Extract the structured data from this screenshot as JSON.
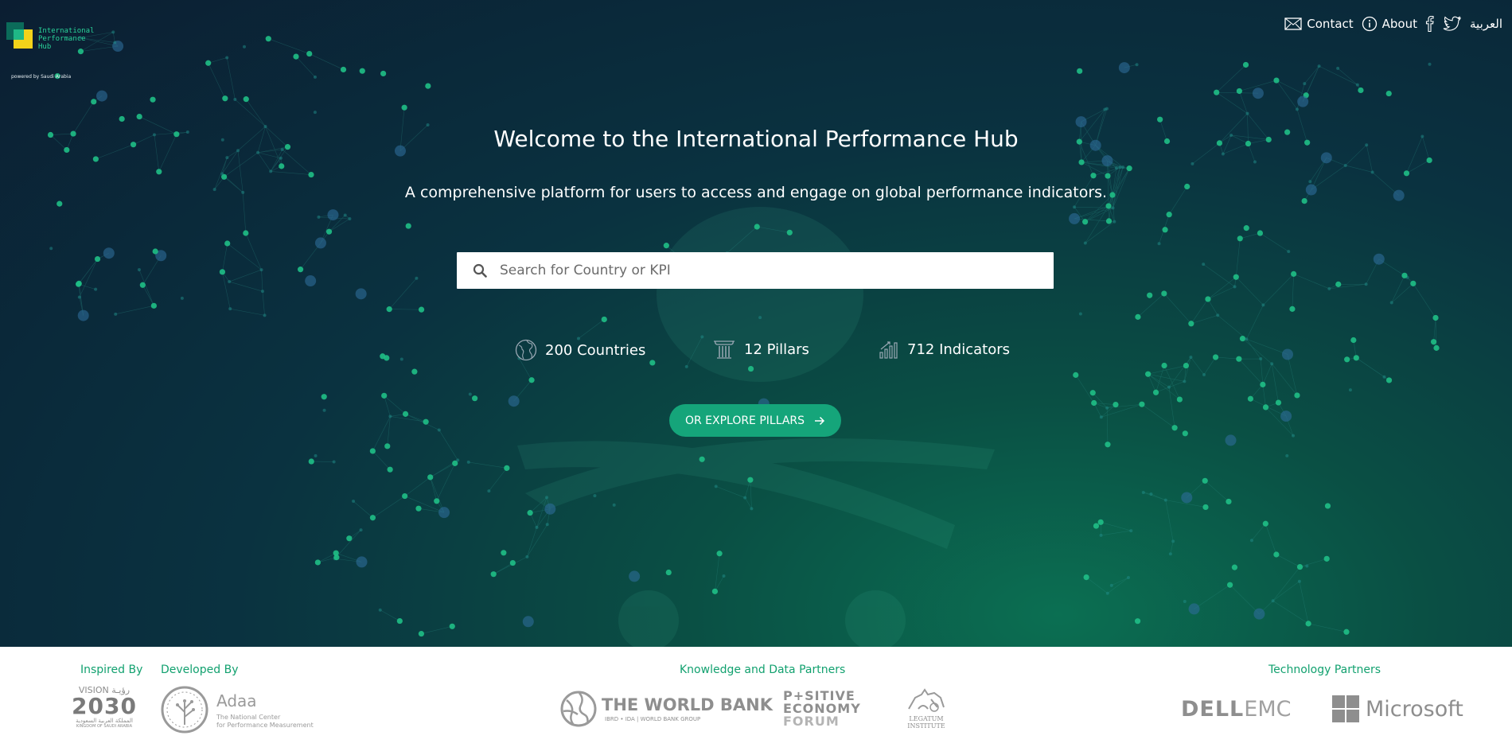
{
  "header": {
    "logo": {
      "text": "International Performance Hub",
      "powered_by": "powered by Saudi Arabia"
    },
    "nav": {
      "contact": "Contact",
      "about": "About",
      "language": "العربية"
    }
  },
  "hero": {
    "title": "Welcome to the International Performance Hub",
    "subtitle": "A comprehensive platform for users to access and engage on global performance indicators.",
    "search_placeholder": "Search for Country or KPI",
    "stats": [
      {
        "label": "200 Countries",
        "icon": "globe-icon"
      },
      {
        "label": "12 Pillars",
        "icon": "pillar-icon"
      },
      {
        "label": "712 Indicators",
        "icon": "indicator-chart-icon"
      }
    ],
    "explore_label": "OR EXPLORE PILLARS"
  },
  "footer": {
    "inspired_by": "Inspired By",
    "developed_by": "Developed By",
    "knowledge_partners": "Knowledge and Data Partners",
    "technology_partners": "Technology Partners",
    "vision": {
      "top": "VISION رؤيـة",
      "num": "2030",
      "line1": "المملكة العربية السعودية",
      "line2": "KINGDOM OF SAUDI ARABIA"
    },
    "adaa": {
      "name": "Adaa",
      "line1": "The National Center",
      "line2": "for Performance Measurement"
    },
    "worldbank": {
      "name": "THE WORLD BANK",
      "sub": "IBRD • IDA | WORLD BANK GROUP"
    },
    "positive": {
      "line1": "P+SITIVE",
      "line2": "ECONOMY",
      "line3": "FORUM"
    },
    "legatum": {
      "line1": "LEGATUM",
      "line2": "INSTITUTE"
    },
    "dell": {
      "bold": "DELL",
      "light": "EMC"
    },
    "microsoft": {
      "name": "Microsoft"
    }
  },
  "colors": {
    "accent": "#15a57a",
    "hero_dark": "#0b1e32",
    "hero_green": "#0b6f52",
    "footer_label": "#12a16f",
    "logo_yellow": "#f3d21a"
  }
}
